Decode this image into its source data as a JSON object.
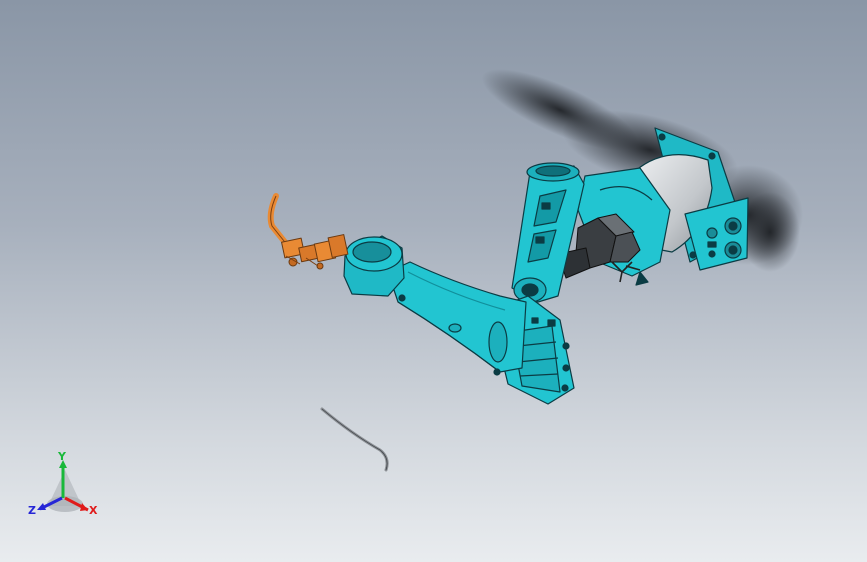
{
  "viewport": {
    "background_top": "#8a96a6",
    "background_bottom": "#e9ecef"
  },
  "model": {
    "primary_color": "#21c3cf",
    "outline_color": "#0b3c44",
    "tool_color": "#e98a34",
    "motor_color": "#c9cdd1"
  },
  "triad": {
    "x_label": "X",
    "y_label": "Y",
    "z_label": "Z",
    "x_color": "#e01b1b",
    "y_color": "#19b83a",
    "z_color": "#2626d6"
  }
}
